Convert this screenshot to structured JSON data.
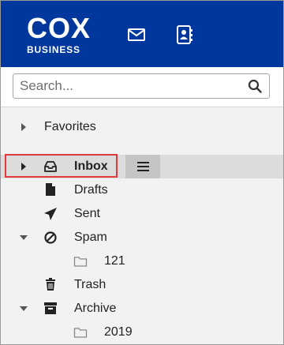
{
  "brand": {
    "logo_main": "COX",
    "logo_sub": "BUSINESS"
  },
  "header": {
    "icons": [
      "mail-icon",
      "contacts-icon"
    ]
  },
  "search": {
    "placeholder": "Search..."
  },
  "folders": {
    "favorites": "Favorites",
    "inbox": "Inbox",
    "drafts": "Drafts",
    "sent": "Sent",
    "spam": "Spam",
    "spam_sub": "121",
    "trash": "Trash",
    "archive": "Archive",
    "archive_sub": "2019"
  },
  "colors": {
    "header_bg": "#00379c",
    "highlight_border": "#e0393e",
    "selected_row": "#dcdcdc"
  }
}
